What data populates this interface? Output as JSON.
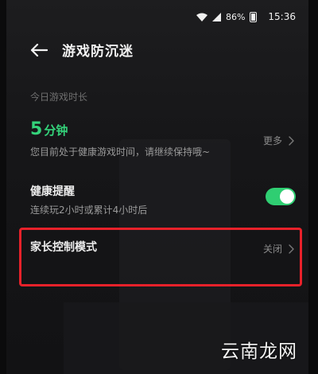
{
  "status_bar": {
    "battery": "86%",
    "time": "15:36"
  },
  "header": {
    "title": "游戏防沉迷"
  },
  "playtime": {
    "section_label": "今日游戏时长",
    "number": "5",
    "unit": "分钟",
    "description": "您目前处于健康游戏时间，请继续保持哦~",
    "more_label": "更多"
  },
  "health_reminder": {
    "title": "健康提醒",
    "description": "连续玩2小时或累计4小时后",
    "enabled": true
  },
  "parental_control": {
    "title": "家长控制模式",
    "status": "关闭"
  },
  "watermark": {
    "text": "云南龙网"
  },
  "colors": {
    "accent_green": "#34d37a",
    "highlight_red": "#e8212a"
  }
}
